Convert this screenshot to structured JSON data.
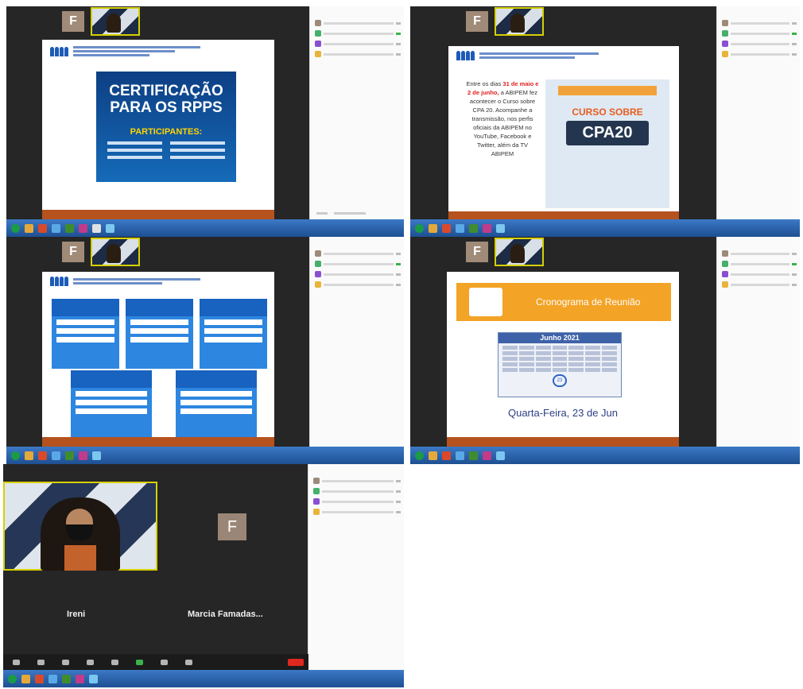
{
  "shot1": {
    "tile_f": "F",
    "slide": {
      "title": "CERTIFICAÇÃO PARA OS RPPS",
      "subtitle": "PARTICIPANTES:"
    }
  },
  "shot2": {
    "tile_f": "F",
    "slide": {
      "body_pre": "Entre os dias",
      "body_dates": "31 de maio e 2 de junho,",
      "body_post": "a ABIPEM fez acontecer o Curso sobre CPA 20. Acompanhe a transmissão, nos perfis oficiais da ABIPEM no YouTube, Facebook e Twitter, além da TV ABIPEM",
      "course_label": "CURSO SOBRE",
      "course_name": "CPA20"
    }
  },
  "shot3": {
    "tile_f": "F"
  },
  "shot4": {
    "tile_f": "F",
    "slide": {
      "banner": "Cronograma de Reunião",
      "calendar_month": "Junho 2021",
      "calendar_highlight": "23",
      "date_text": "Quarta-Feira, 23 de Jun"
    }
  },
  "shot5": {
    "tile_f": "F",
    "names": [
      "Ireni",
      "Marcia Famadas..."
    ]
  },
  "colors": {
    "zoom_dark": "#262626",
    "taskbar_blue": "#2a62ad",
    "slide_footer": "#b5521e",
    "cert_blue": "#0d3f84",
    "accent_orange": "#f3a326",
    "highlight_yellow": "#d6d000"
  }
}
